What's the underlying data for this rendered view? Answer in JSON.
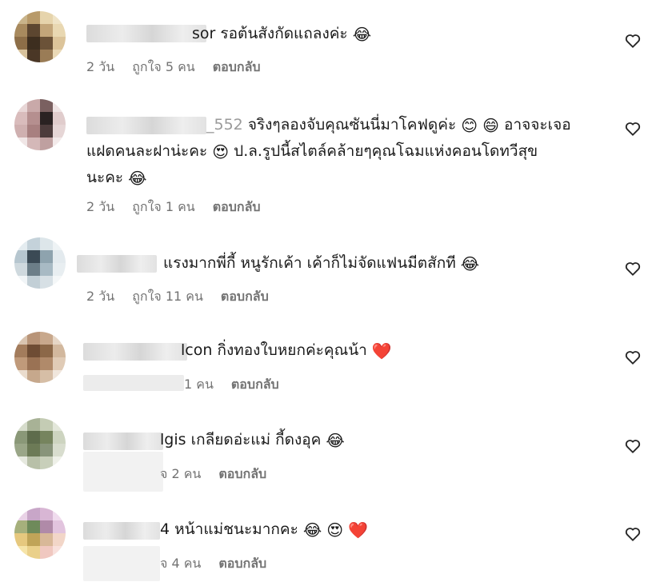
{
  "comments": [
    {
      "visible_name_tail": "sor",
      "text": "รอต้นสังกัดแถลงค่ะ",
      "emoji": [
        "😂"
      ],
      "time": "2 วัน",
      "likes": "ถูกใจ 5 คน",
      "reply": "ตอบกลับ"
    },
    {
      "visible_name_tail": "_552",
      "text_line1": "จริงๆลองจับคุณซันนี่มาโคฟดูค่ะ",
      "text_line1_emoji": [
        "😊",
        "😄"
      ],
      "text_line1_tail": "อาจจะเจอ",
      "text_line2": "แฝดคนละฝาน่ะคะ",
      "text_line2_emoji": [
        "😍"
      ],
      "text_line2_tail": "ป.ล.รูปนี้สไตล์คล้ายๆคุณโฉมแห่งคอนโดทวีสุข",
      "text_line3": "นะคะ",
      "text_line3_emoji": [
        "😂"
      ],
      "time": "2 วัน",
      "likes": "ถูกใจ 1 คน",
      "reply": "ตอบกลับ"
    },
    {
      "text": "แรงมากพี่กี้ หนูรักเค้า เค้าก็ไม่จัดแฟนมีตสักที",
      "emoji": [
        "😂"
      ],
      "time": "2 วัน",
      "likes": "ถูกใจ 11 คน",
      "reply": "ตอบกลับ"
    },
    {
      "visible_name_tail": "lcon",
      "text": "กิ่งทองใบหยกค่ะคุณน้า",
      "emoji": [
        "❤️"
      ],
      "likes": "1 คน",
      "reply": "ตอบกลับ"
    },
    {
      "visible_name_tail": "lgis",
      "text": "เกลียดอ่ะแม่ กี้ดงอุค",
      "emoji": [
        "😂"
      ],
      "likes": "จ 2 คน",
      "reply": "ตอบกลับ"
    },
    {
      "visible_name_tail": "4",
      "text": "หน้าแม่ชนะมากคะ",
      "emoji": [
        "😂",
        "😍",
        "❤️"
      ],
      "likes": "จ 4 คน",
      "reply": "ตอบกลับ"
    }
  ],
  "icons": {
    "like": "heart-outline-icon"
  }
}
